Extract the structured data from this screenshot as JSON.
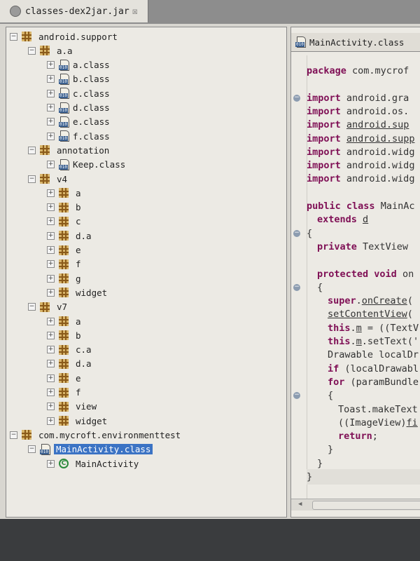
{
  "tab": {
    "title": "classes-dex2jar.jar",
    "close": "☒"
  },
  "editor_tab": {
    "title": "MainActivity.class"
  },
  "tree": [
    {
      "label": "android.support",
      "level": 0,
      "type": "package",
      "expanded": true
    },
    {
      "label": "a.a",
      "level": 1,
      "type": "package",
      "expanded": true
    },
    {
      "label": "a.class",
      "level": 2,
      "type": "class",
      "expanded": false
    },
    {
      "label": "b.class",
      "level": 2,
      "type": "class",
      "expanded": false
    },
    {
      "label": "c.class",
      "level": 2,
      "type": "class",
      "expanded": false
    },
    {
      "label": "d.class",
      "level": 2,
      "type": "class",
      "expanded": false
    },
    {
      "label": "e.class",
      "level": 2,
      "type": "class",
      "expanded": false
    },
    {
      "label": "f.class",
      "level": 2,
      "type": "class",
      "expanded": false
    },
    {
      "label": "annotation",
      "level": 1,
      "type": "package",
      "expanded": true
    },
    {
      "label": "Keep.class",
      "level": 2,
      "type": "class",
      "expanded": false
    },
    {
      "label": "v4",
      "level": 1,
      "type": "package",
      "expanded": true
    },
    {
      "label": "a",
      "level": 2,
      "type": "package",
      "expanded": false
    },
    {
      "label": "b",
      "level": 2,
      "type": "package",
      "expanded": false
    },
    {
      "label": "c",
      "level": 2,
      "type": "package",
      "expanded": false
    },
    {
      "label": "d.a",
      "level": 2,
      "type": "package",
      "expanded": false
    },
    {
      "label": "e",
      "level": 2,
      "type": "package",
      "expanded": false
    },
    {
      "label": "f",
      "level": 2,
      "type": "package",
      "expanded": false
    },
    {
      "label": "g",
      "level": 2,
      "type": "package",
      "expanded": false
    },
    {
      "label": "widget",
      "level": 2,
      "type": "package",
      "expanded": false
    },
    {
      "label": "v7",
      "level": 1,
      "type": "package",
      "expanded": true
    },
    {
      "label": "a",
      "level": 2,
      "type": "package",
      "expanded": false
    },
    {
      "label": "b",
      "level": 2,
      "type": "package",
      "expanded": false
    },
    {
      "label": "c.a",
      "level": 2,
      "type": "package",
      "expanded": false
    },
    {
      "label": "d.a",
      "level": 2,
      "type": "package",
      "expanded": false
    },
    {
      "label": "e",
      "level": 2,
      "type": "package",
      "expanded": false
    },
    {
      "label": "f",
      "level": 2,
      "type": "package",
      "expanded": false
    },
    {
      "label": "view",
      "level": 2,
      "type": "package",
      "expanded": false
    },
    {
      "label": "widget",
      "level": 2,
      "type": "package",
      "expanded": false
    },
    {
      "label": "com.mycroft.environmenttest",
      "level": 0,
      "type": "package",
      "expanded": true
    },
    {
      "label": "MainActivity.class",
      "level": 1,
      "type": "class",
      "expanded": true,
      "selected": true
    },
    {
      "label": "MainActivity",
      "level": 2,
      "type": "classnode",
      "expanded": false
    }
  ],
  "code": [
    {
      "indent": 0,
      "fold": false,
      "tokens": [
        {
          "t": "package",
          "s": "kw"
        },
        {
          "t": " com.mycrof"
        }
      ]
    },
    {
      "indent": 0,
      "fold": false,
      "tokens": []
    },
    {
      "indent": 0,
      "fold": true,
      "tokens": [
        {
          "t": "import",
          "s": "kw"
        },
        {
          "t": " android.gra"
        }
      ]
    },
    {
      "indent": 0,
      "fold": false,
      "tokens": [
        {
          "t": "import",
          "s": "kw"
        },
        {
          "t": " android.os."
        }
      ]
    },
    {
      "indent": 0,
      "fold": false,
      "tokens": [
        {
          "t": "import",
          "s": "kw"
        },
        {
          "t": " "
        },
        {
          "t": "android.sup",
          "s": "u"
        }
      ]
    },
    {
      "indent": 0,
      "fold": false,
      "tokens": [
        {
          "t": "import",
          "s": "kw"
        },
        {
          "t": " "
        },
        {
          "t": "android.supp",
          "s": "u"
        }
      ]
    },
    {
      "indent": 0,
      "fold": false,
      "tokens": [
        {
          "t": "import",
          "s": "kw"
        },
        {
          "t": " android.widg"
        }
      ]
    },
    {
      "indent": 0,
      "fold": false,
      "tokens": [
        {
          "t": "import",
          "s": "kw"
        },
        {
          "t": " android.widg"
        }
      ]
    },
    {
      "indent": 0,
      "fold": false,
      "tokens": [
        {
          "t": "import",
          "s": "kw"
        },
        {
          "t": " android.widg"
        }
      ]
    },
    {
      "indent": 0,
      "fold": false,
      "tokens": []
    },
    {
      "indent": 0,
      "fold": false,
      "tokens": [
        {
          "t": "public",
          "s": "kw"
        },
        {
          "t": " "
        },
        {
          "t": "class",
          "s": "kw"
        },
        {
          "t": " MainAc"
        }
      ]
    },
    {
      "indent": 1,
      "fold": false,
      "tokens": [
        {
          "t": "extends",
          "s": "kw"
        },
        {
          "t": " "
        },
        {
          "t": "d",
          "s": "u"
        }
      ]
    },
    {
      "indent": 0,
      "fold": true,
      "tokens": [
        {
          "t": "{"
        }
      ]
    },
    {
      "indent": 1,
      "fold": false,
      "tokens": [
        {
          "t": "private",
          "s": "kw"
        },
        {
          "t": " TextView"
        }
      ]
    },
    {
      "indent": 0,
      "fold": false,
      "tokens": []
    },
    {
      "indent": 1,
      "fold": false,
      "tokens": [
        {
          "t": "protected",
          "s": "kw"
        },
        {
          "t": " "
        },
        {
          "t": "void",
          "s": "kw"
        },
        {
          "t": " on"
        }
      ]
    },
    {
      "indent": 1,
      "fold": true,
      "tokens": [
        {
          "t": "{"
        }
      ]
    },
    {
      "indent": 2,
      "fold": false,
      "tokens": [
        {
          "t": "super",
          "s": "kw"
        },
        {
          "t": "."
        },
        {
          "t": "onCreate",
          "s": "u"
        },
        {
          "t": "("
        }
      ]
    },
    {
      "indent": 2,
      "fold": false,
      "tokens": [
        {
          "t": "setContentView",
          "s": "u"
        },
        {
          "t": "("
        }
      ]
    },
    {
      "indent": 2,
      "fold": false,
      "tokens": [
        {
          "t": "this",
          "s": "kw"
        },
        {
          "t": "."
        },
        {
          "t": "m",
          "s": "u"
        },
        {
          "t": " = ((TextV"
        }
      ]
    },
    {
      "indent": 2,
      "fold": false,
      "tokens": [
        {
          "t": "this",
          "s": "kw"
        },
        {
          "t": "."
        },
        {
          "t": "m",
          "s": "u"
        },
        {
          "t": ".setText('"
        }
      ]
    },
    {
      "indent": 2,
      "fold": false,
      "tokens": [
        {
          "t": "Drawable localDr"
        }
      ]
    },
    {
      "indent": 2,
      "fold": false,
      "tokens": [
        {
          "t": "if",
          "s": "kw"
        },
        {
          "t": " (localDrawabl"
        }
      ]
    },
    {
      "indent": 2,
      "fold": false,
      "tokens": [
        {
          "t": "for",
          "s": "kw"
        },
        {
          "t": " (paramBundle"
        }
      ]
    },
    {
      "indent": 2,
      "fold": true,
      "tokens": [
        {
          "t": "{"
        }
      ]
    },
    {
      "indent": 3,
      "fold": false,
      "tokens": [
        {
          "t": "Toast.makeText"
        }
      ]
    },
    {
      "indent": 3,
      "fold": false,
      "tokens": [
        {
          "t": "((ImageView)"
        },
        {
          "t": "fi",
          "s": "u"
        }
      ]
    },
    {
      "indent": 3,
      "fold": false,
      "tokens": [
        {
          "t": "return",
          "s": "kw"
        },
        {
          "t": ";"
        }
      ]
    },
    {
      "indent": 2,
      "fold": false,
      "tokens": [
        {
          "t": "}"
        }
      ]
    },
    {
      "indent": 1,
      "fold": false,
      "tokens": [
        {
          "t": "}"
        }
      ]
    },
    {
      "indent": 0,
      "fold": false,
      "tokens": [
        {
          "t": "}"
        }
      ]
    }
  ]
}
